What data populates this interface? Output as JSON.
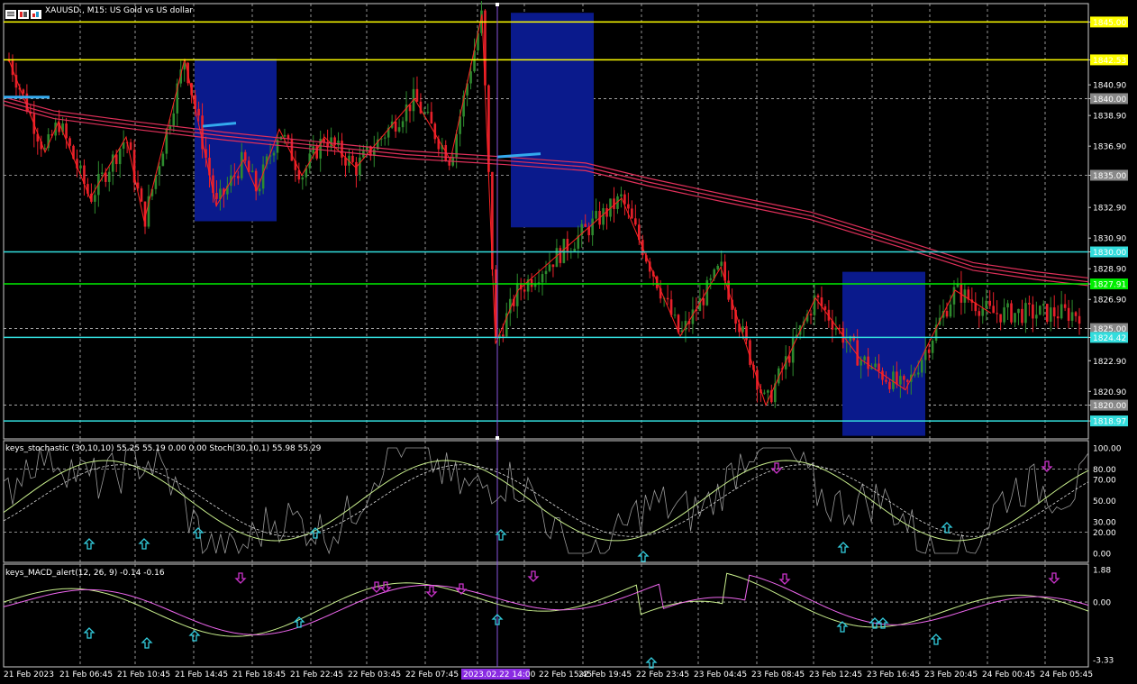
{
  "header": {
    "symbol": "XAUUSD., M15:",
    "description": "US Gold vs US dollar"
  },
  "subwindows": {
    "stochastic_title": "keys_stochastic (30,10,10) 55.25 55.19 0.00 0.00 Stoch(30,10,1) 55.98 55.29",
    "macd_title": "keys_MACD_alert(12, 26, 9) -0.14 -0.16"
  },
  "colors": {
    "background": "#000000",
    "up_candle": "#2e8b2e",
    "down_candle": "#e8202a",
    "ma_band": "#e0305a",
    "zone_box": "#0a1a8c",
    "yellow_line": "#ffff00",
    "cyan_line": "#33dddd",
    "green_line": "#00ee00",
    "arrow_up": "#33ccdd",
    "arrow_down": "#cc33cc",
    "crosshair": "#8855dd",
    "grid": "#bbbbbb"
  },
  "chart_data": {
    "type": "candlestick",
    "price_axis_labels": [
      "1845.00",
      "1842.53",
      "1840.90",
      "1840.00",
      "1838.90",
      "1836.90",
      "1835.00",
      "1832.90",
      "1830.90",
      "1830.00",
      "1828.90",
      "1827.91",
      "1826.90",
      "1825.00",
      "1824.42",
      "1822.90",
      "1820.90",
      "1820.00",
      "1818.97"
    ],
    "horizontal_levels": [
      {
        "price": 1845.0,
        "kind": "yellow",
        "label": "1845.00"
      },
      {
        "price": 1842.53,
        "kind": "yellow",
        "label": "1842.53"
      },
      {
        "price": 1830.0,
        "kind": "cyan",
        "label": "1830.00"
      },
      {
        "price": 1827.91,
        "kind": "green",
        "label": "1827.91"
      },
      {
        "price": 1824.42,
        "kind": "cyan",
        "label": "1824.42"
      },
      {
        "price": 1818.97,
        "kind": "cyan",
        "label": "1818.97"
      }
    ],
    "time_labels": [
      "21 Feb 2023",
      "21 Feb 06:45",
      "21 Feb 10:45",
      "21 Feb 14:45",
      "21 Feb 18:45",
      "21 Feb 22:45",
      "22 Feb 03:45",
      "22 Feb 07:45",
      "2023.02.22 14:00",
      "22 Feb 15:45",
      "22 Feb 19:45",
      "22 Feb 23:45",
      "23 Feb 04:45",
      "23 Feb 08:45",
      "23 Feb 12:45",
      "23 Feb 16:45",
      "23 Feb 20:45",
      "24 Feb 00:45",
      "24 Feb 05:45"
    ],
    "stochastic_axis_labels": [
      "100.00",
      "80.00",
      "70.00",
      "50.00",
      "30.00",
      "20.00",
      "0.00"
    ],
    "macd_axis_labels": [
      "1.88",
      "0.00",
      "-3.33"
    ],
    "zigzag_prices": [
      1842.5,
      1836.5,
      1838.5,
      1833.5,
      1837.5,
      1832.0,
      1842.6,
      1833.0,
      1836.0,
      1834.0,
      1838.0,
      1835.0,
      1837.5,
      1835.5,
      1840.0,
      1836.0,
      1845.5,
      1824.0,
      1827.5,
      1833.5,
      1824.5,
      1829.0,
      1820.0,
      1827.0,
      1823.0,
      1821.0,
      1827.5,
      1826.0
    ],
    "zone_boxes": [
      {
        "from_price": 1842.6,
        "to_price": 1832.0,
        "label": ""
      },
      {
        "from_price": 1845.6,
        "to_price": 1831.6,
        "label": ""
      },
      {
        "from_price": 1828.7,
        "to_price": 1818.0,
        "label": ""
      }
    ]
  }
}
